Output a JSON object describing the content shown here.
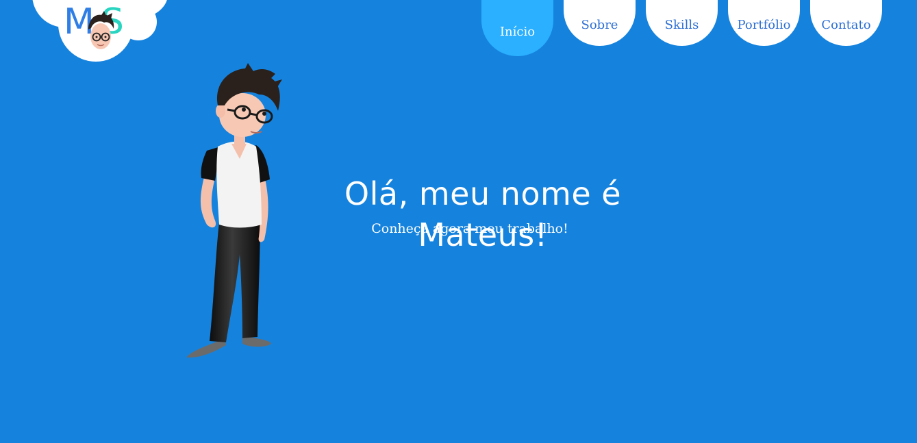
{
  "logo": {
    "letter_m": "M",
    "letter_s": "S"
  },
  "nav": {
    "items": [
      {
        "label": "Início",
        "active": true
      },
      {
        "label": "Sobre",
        "active": false
      },
      {
        "label": "Skills",
        "active": false
      },
      {
        "label": "Portfólio",
        "active": false
      },
      {
        "label": "Contato",
        "active": false
      }
    ]
  },
  "hero": {
    "title": "Olá, meu nome é Mateus!",
    "subtitle": "Conheça agora meu trabalho!"
  },
  "colors": {
    "background": "#1583de",
    "nav_bg": "#ffffff",
    "nav_text": "#2d6fd3",
    "nav_active_bg": "#2ab0ff",
    "nav_active_text": "#ffffff",
    "logo_m": "#2f7ee6",
    "logo_s": "#29d4c0"
  },
  "icons": {
    "logo_face": "cartoon-face-with-glasses-icon",
    "character": "cartoon-boy-character-illustration"
  }
}
